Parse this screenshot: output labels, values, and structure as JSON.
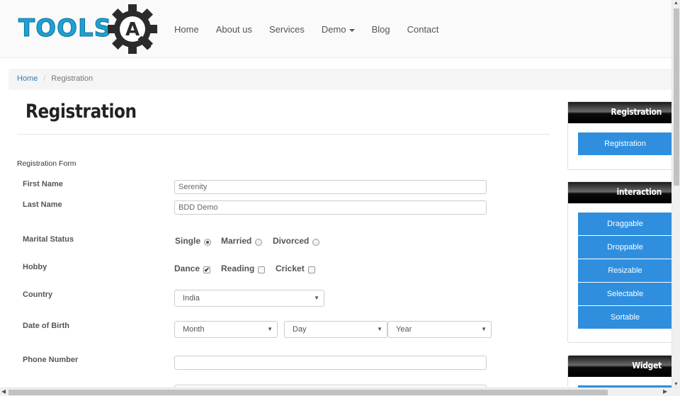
{
  "header": {
    "logo_text": "TOOLS",
    "logo_badge": "A",
    "nav": [
      {
        "label": "Home"
      },
      {
        "label": "About us"
      },
      {
        "label": "Services"
      },
      {
        "label": "Demo"
      },
      {
        "label": "Blog"
      },
      {
        "label": "Contact"
      }
    ]
  },
  "breadcrumb": {
    "home": "Home",
    "separator": "/",
    "current": "Registration"
  },
  "page": {
    "title": "Registration",
    "form_heading": "Registration Form"
  },
  "form": {
    "first_name": {
      "label": "First Name",
      "value": "Serenity"
    },
    "last_name": {
      "label": "Last Name",
      "value": "BDD Demo"
    },
    "marital_status": {
      "label": "Marital Status",
      "options": [
        {
          "label": "Single",
          "checked": true
        },
        {
          "label": "Married",
          "checked": false
        },
        {
          "label": "Divorced",
          "checked": false
        }
      ]
    },
    "hobby": {
      "label": "Hobby",
      "options": [
        {
          "label": "Dance",
          "checked": true
        },
        {
          "label": "Reading",
          "checked": false
        },
        {
          "label": "Cricket",
          "checked": false
        }
      ]
    },
    "country": {
      "label": "Country",
      "value": "India"
    },
    "dob": {
      "label": "Date of Birth",
      "month": "Month",
      "day": "Day",
      "year": "Year"
    },
    "phone": {
      "label": "Phone Number",
      "value": ""
    }
  },
  "sidebar": {
    "widgets": [
      {
        "title": "Registration",
        "items": [
          "Registration"
        ]
      },
      {
        "title": "interaction",
        "items": [
          "Draggable",
          "Droppable",
          "Resizable",
          "Selectable",
          "Sortable"
        ]
      },
      {
        "title": "Widget",
        "items": []
      }
    ]
  },
  "colors": {
    "logo": "#1da1d6",
    "button": "#2f8fde",
    "link": "#337ab7"
  },
  "icons": {
    "logo_gear": "gear-icon",
    "select_arrow": "chevron-down-icon"
  }
}
